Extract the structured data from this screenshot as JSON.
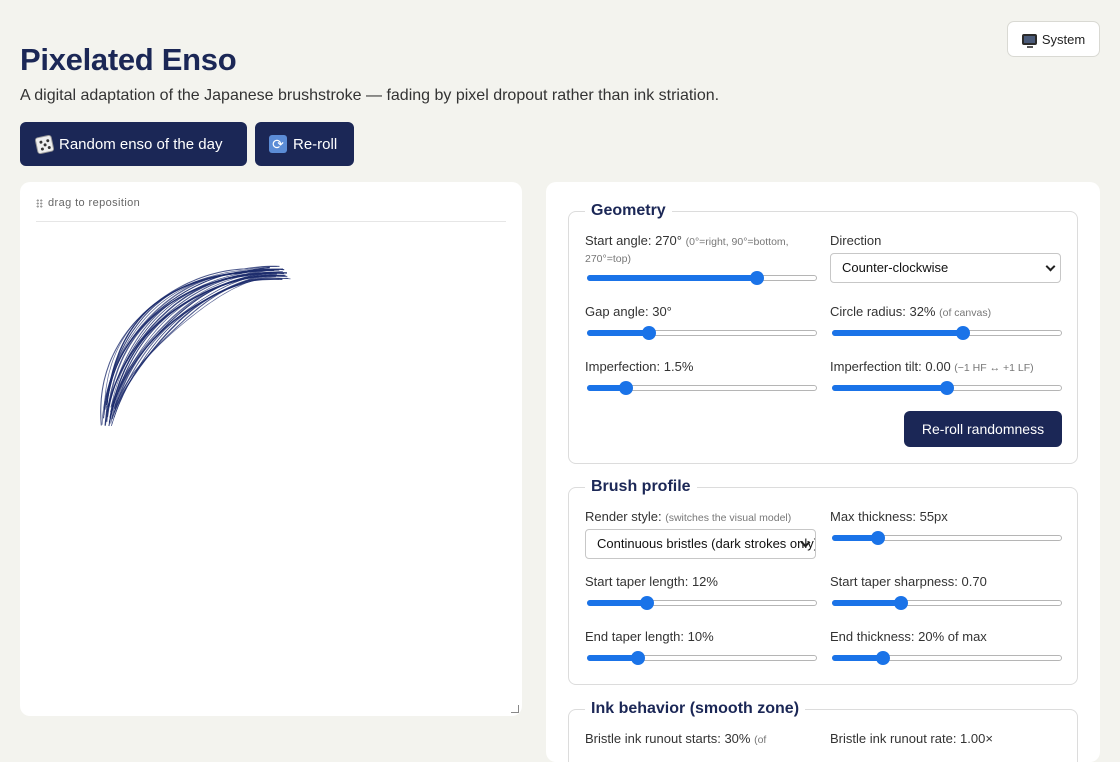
{
  "header": {
    "title": "Pixelated Enso",
    "subtitle": "A digital adaptation of the Japanese brushstroke — fading by pixel dropout rather than ink striation.",
    "theme_label": "System"
  },
  "actions": {
    "random_label": "Random enso of the day",
    "reroll_label": "Re-roll"
  },
  "canvas": {
    "drag_label": "drag to reposition",
    "ink_color": "#1b2a6b"
  },
  "geometry": {
    "title": "Geometry",
    "start_angle": {
      "label": "Start angle: 270°",
      "hint": "(0°=right, 90°=bottom, 270°=top)",
      "value": 0.74
    },
    "direction": {
      "label": "Direction",
      "selected": "Counter-clockwise"
    },
    "gap_angle": {
      "label": "Gap angle: 30°",
      "value": 0.27
    },
    "circle_radius": {
      "label": "Circle radius: 32%",
      "hint": "(of canvas)",
      "value": 0.57
    },
    "imperfection": {
      "label": "Imperfection: 1.5%",
      "value": 0.17
    },
    "imperfection_tilt": {
      "label": "Imperfection tilt: 0.00",
      "hint": "(−1 HF ↔ +1 LF)",
      "value": 0.5
    },
    "reroll_randomness_label": "Re-roll randomness"
  },
  "brush_profile": {
    "title": "Brush profile",
    "render_style": {
      "label": "Render style:",
      "hint": "(switches the visual model)",
      "selected": "Continuous bristles (dark strokes only)"
    },
    "max_thickness": {
      "label": "Max thickness: 55px",
      "value": 0.2
    },
    "start_taper_length": {
      "label": "Start taper length: 12%",
      "value": 0.26
    },
    "start_taper_sharpness": {
      "label": "Start taper sharpness: 0.70",
      "value": 0.3
    },
    "end_taper_length": {
      "label": "End taper length: 10%",
      "value": 0.22
    },
    "end_thickness": {
      "label": "End thickness: 20% of max",
      "value": 0.22
    }
  },
  "ink_behavior": {
    "title": "Ink behavior (smooth zone)",
    "runout_starts": {
      "label": "Bristle ink runout starts: 30%",
      "hint": "(of"
    },
    "runout_rate": {
      "label": "Bristle ink runout rate: 1.00×"
    }
  },
  "colors": {
    "accent": "#1b2756",
    "slider": "#1a73e8",
    "background": "#f3f3ee"
  }
}
